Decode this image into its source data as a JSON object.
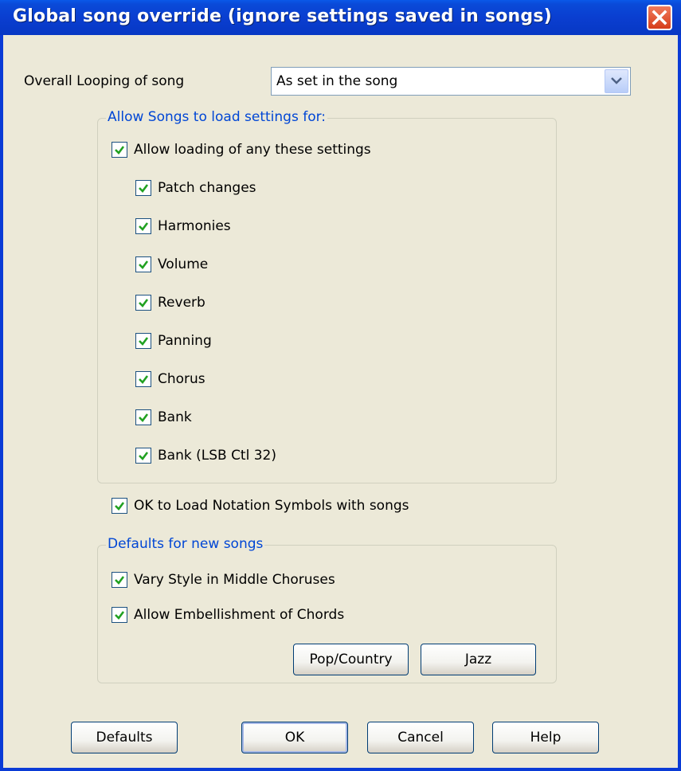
{
  "window": {
    "title": "Global song override (ignore settings saved in songs)"
  },
  "looping": {
    "label": "Overall Looping of song",
    "selected": "As set in the song"
  },
  "allow_group": {
    "title": "Allow Songs to load settings for:",
    "master": {
      "label": "Allow loading of any these settings",
      "checked": true
    },
    "items": [
      {
        "label": "Patch changes",
        "checked": true
      },
      {
        "label": "Harmonies",
        "checked": true
      },
      {
        "label": "Volume",
        "checked": true
      },
      {
        "label": "Reverb",
        "checked": true
      },
      {
        "label": "Panning",
        "checked": true
      },
      {
        "label": "Chorus",
        "checked": true
      },
      {
        "label": "Bank",
        "checked": true
      },
      {
        "label": "Bank (LSB Ctl 32)",
        "checked": true
      }
    ]
  },
  "notation": {
    "label": "OK to Load Notation Symbols with songs",
    "checked": true
  },
  "defaults_group": {
    "title": "Defaults for new songs",
    "vary": {
      "label": "Vary Style in Middle Choruses",
      "checked": true
    },
    "embellish": {
      "label": "Allow Embellishment of Chords",
      "checked": true
    },
    "pop_button": "Pop/Country",
    "jazz_button": "Jazz"
  },
  "footer": {
    "defaults": "Defaults",
    "ok": "OK",
    "cancel": "Cancel",
    "help": "Help"
  },
  "colors": {
    "titlebar": "#0a3ed0",
    "dialog_bg": "#ece9d8",
    "group_title": "#0046d5",
    "check": "#21a121"
  }
}
